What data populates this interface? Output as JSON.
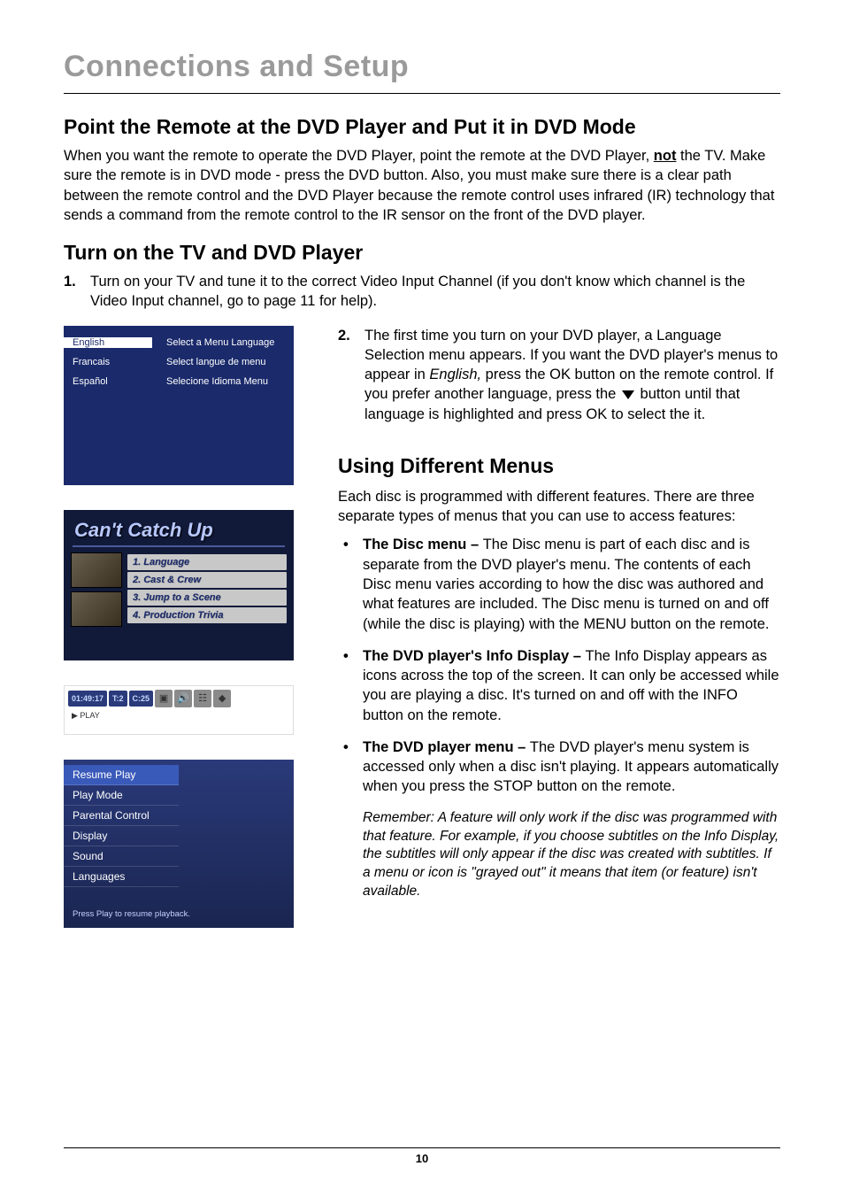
{
  "page": {
    "title": "Connections and Setup",
    "number": "10"
  },
  "section1": {
    "heading": "Point the Remote at the DVD Player and Put it in DVD Mode",
    "para_pre": "When you want the remote to operate the DVD Player, point the remote at the DVD Player, ",
    "para_underline": "not",
    "para_post": " the TV. Make sure the remote is in DVD mode - press the DVD button. Also, you must make sure there is a clear path between the remote control and the DVD Player because the remote control uses infrared (IR) technology that sends a command from the remote control to the IR sensor on the front of the DVD player."
  },
  "section2": {
    "heading": "Turn on the TV and DVD Player",
    "step1_num": "1.",
    "step1_text": "Turn on your TV and tune it to the correct Video Input Channel (if you don't know which channel is the Video Input channel, go to page 11 for help).",
    "step2_num": "2.",
    "step2_pre": "The first time you turn on your DVD player, a Language Selection menu appears. If you want the DVD player's menus to appear in ",
    "step2_em": "English,",
    "step2_mid": " press the OK button on the remote control. If you prefer another language, press the ",
    "step2_post": " button until that language is highlighted and press OK to select the it."
  },
  "lang_menu": {
    "left": [
      "English",
      "Francais",
      "Español"
    ],
    "right": [
      "Select a Menu Language",
      "Select langue de menu",
      "Selecione Idioma Menu"
    ]
  },
  "catchup": {
    "title": "Can't Catch Up",
    "items": [
      "1. Language",
      "2. Cast & Crew",
      "3. Jump to a Scene",
      "4. Production Trivia"
    ]
  },
  "info_bar": {
    "time": "01:49:17",
    "t": "T:2",
    "c": "C:25",
    "sub": "▶ PLAY"
  },
  "player_menu": {
    "items": [
      "Resume Play",
      "Play Mode",
      "Parental Control",
      "Display",
      "Sound",
      "Languages"
    ],
    "footer": "Press Play to resume playback."
  },
  "section3": {
    "heading": "Using Different Menus",
    "intro": "Each disc is programmed with different features. There are three separate types of menus that you can use to access features:",
    "b1_label": "The Disc menu – ",
    "b1_text": "The Disc menu is part of each disc and is separate from the DVD player's menu. The contents of each Disc menu varies according to how the disc was authored and what features are included. The Disc menu is turned on and off (while the disc is playing) with the MENU button on the remote.",
    "b2_label": "The DVD player's Info Display – ",
    "b2_text": "The Info Display appears as icons across the top of the screen. It can only be accessed while you are playing a disc. It's turned on and off with the INFO button on the remote.",
    "b3_label": "The DVD player menu – ",
    "b3_text": "The DVD player's menu system is accessed only when a disc isn't playing. It appears automatically when you press the STOP button on the remote.",
    "note": "Remember: A feature will only work if the disc was programmed with that feature. For example, if you choose subtitles on the Info Display, the subtitles will only appear if the disc was created with subtitles. If a menu or icon is \"grayed out\" it means that item (or feature) isn't available."
  }
}
